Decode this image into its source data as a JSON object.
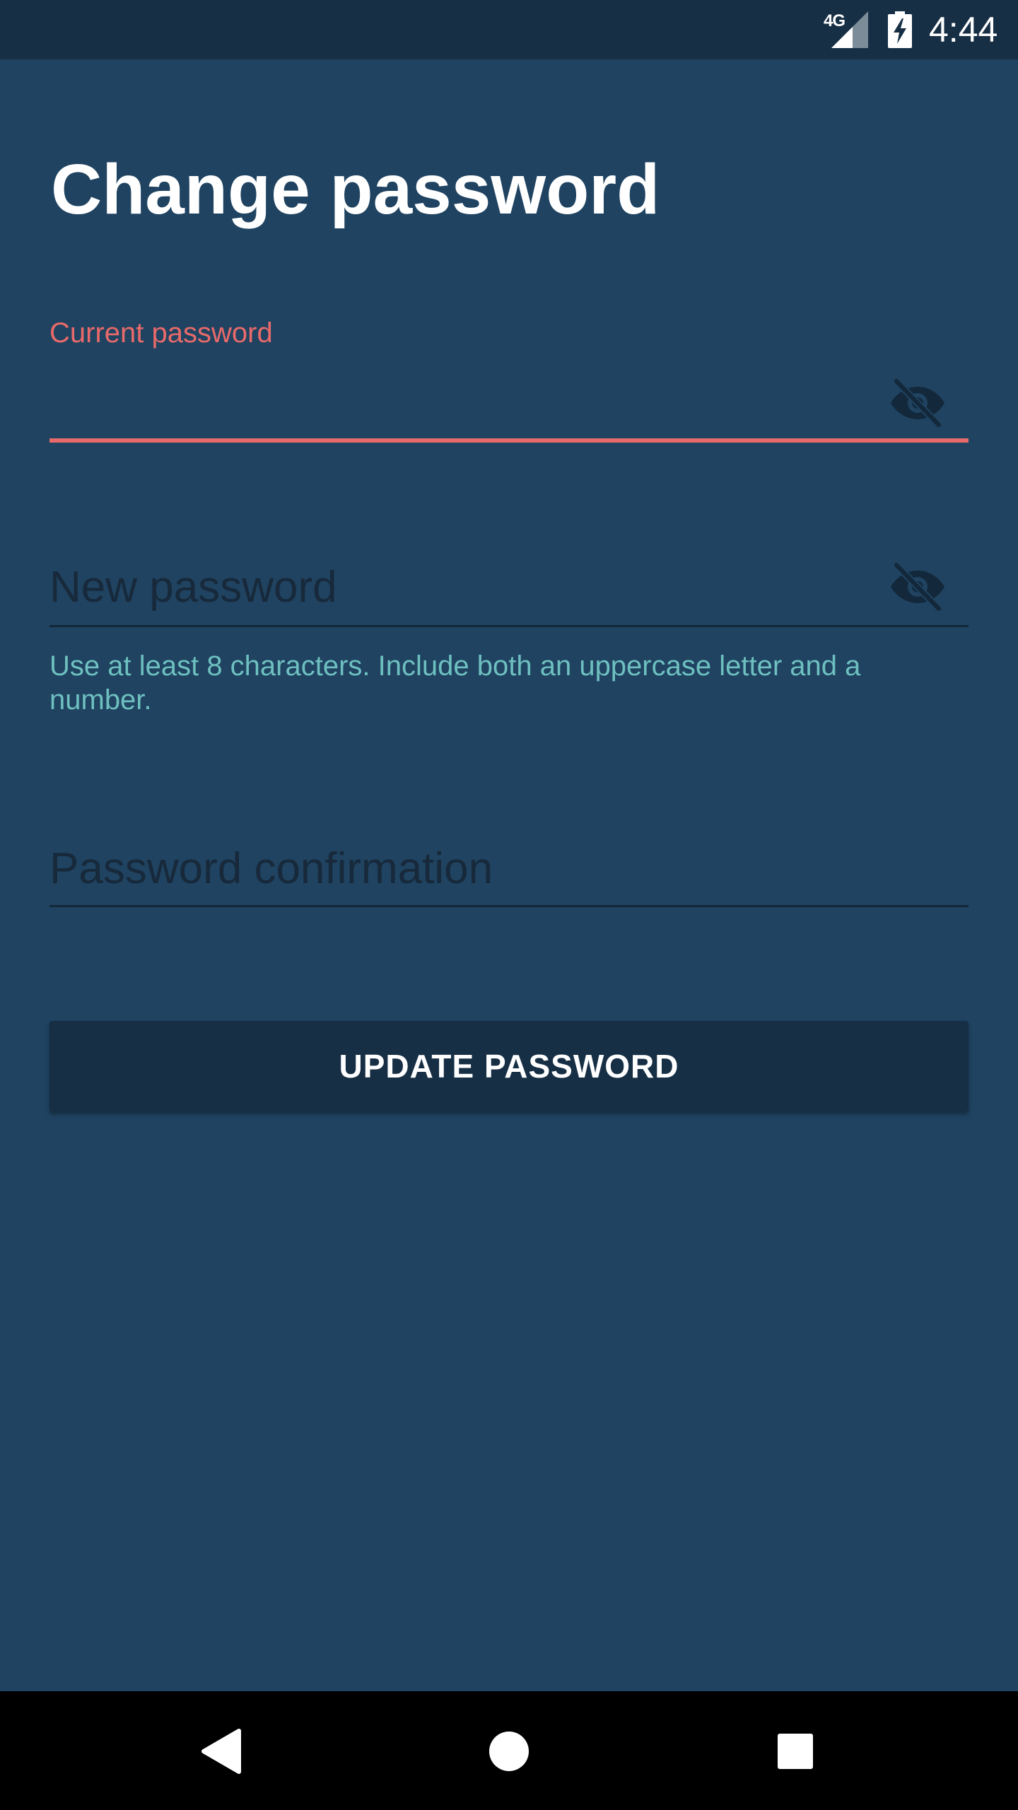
{
  "status_bar": {
    "network": "4G",
    "time": "4:44",
    "icons": [
      "signal-icon",
      "battery-charging-icon"
    ]
  },
  "page": {
    "title": "Change password"
  },
  "fields": {
    "current": {
      "label": "Current password",
      "value": "",
      "state": "focused-error"
    },
    "new": {
      "placeholder": "New password",
      "value": "",
      "helper": "Use at least 8 characters. Include both an uppercase letter and a number."
    },
    "confirm": {
      "placeholder": "Password confirmation",
      "value": ""
    }
  },
  "actions": {
    "update_label": "UPDATE PASSWORD"
  },
  "colors": {
    "background": "#1f4361",
    "status_bar": "#172f45",
    "button": "#172f45",
    "error": "#e86a6a",
    "helper": "#6ec0c0",
    "nav_bar": "#000000"
  },
  "icons": {
    "visibility_toggle": "eye-off-icon",
    "nav": [
      "back-icon",
      "home-icon",
      "recents-icon"
    ]
  }
}
